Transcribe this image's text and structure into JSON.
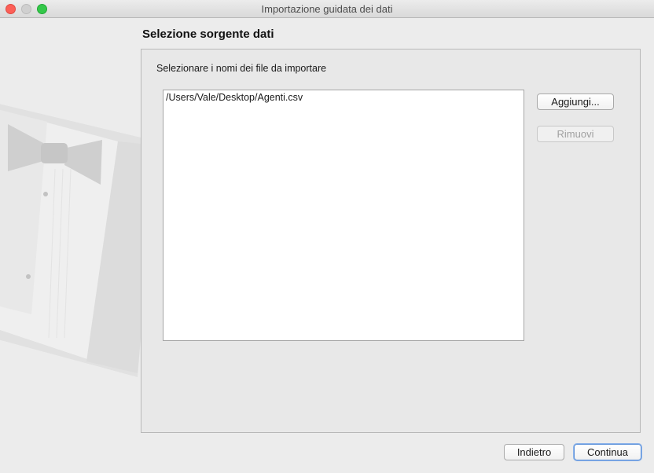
{
  "window": {
    "title": "Importazione guidata dei dati"
  },
  "main": {
    "heading": "Selezione sorgente dati",
    "instruction": "Selezionare i nomi dei file da importare",
    "files": [
      "/Users/Vale/Desktop/Agenti.csv"
    ]
  },
  "buttons": {
    "add": "Aggiungi...",
    "remove": "Rimuovi",
    "back": "Indietro",
    "continue": "Continua"
  },
  "colors": {
    "close": "#fc5f57",
    "maximize": "#34c84a",
    "default_button_focus": "#5a8fd8"
  },
  "icons": {
    "illustration": "tuxedo-bowtie-illustration"
  }
}
